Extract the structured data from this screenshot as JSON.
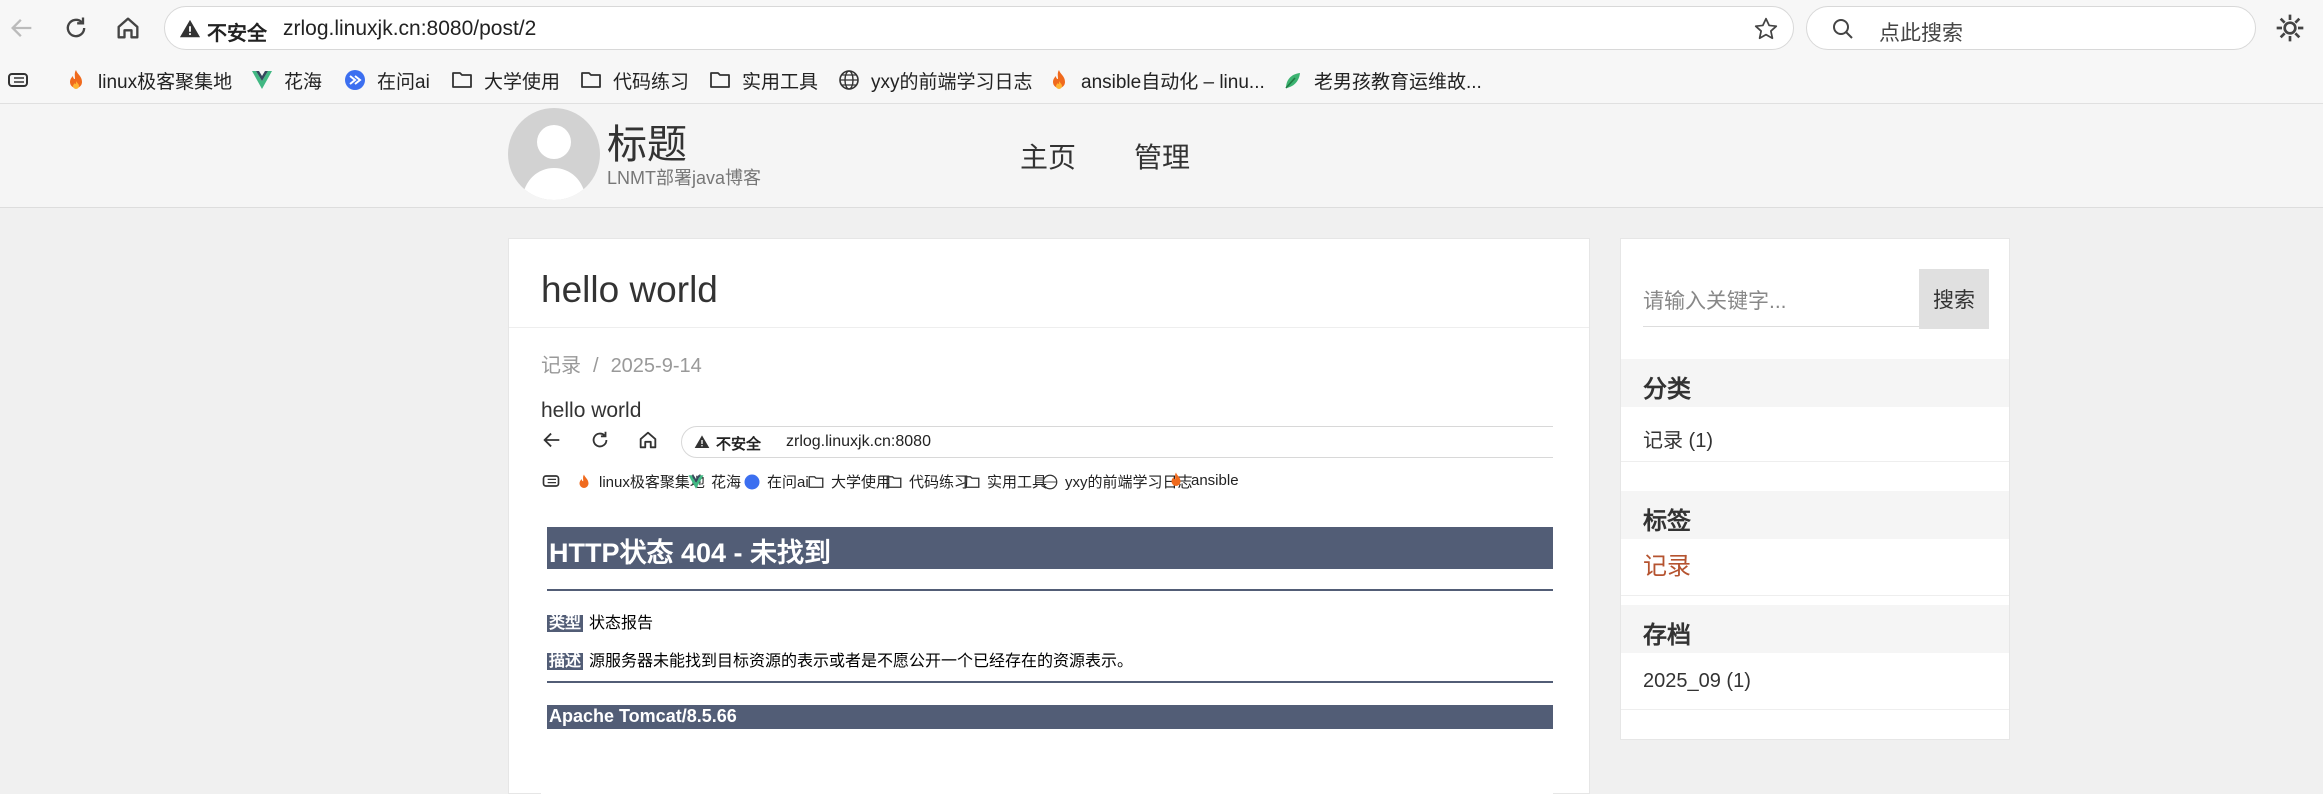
{
  "browser": {
    "insecure_label": "不安全",
    "url": "zrlog.linuxjk.cn:8080/post/2",
    "search_placeholder": "点此搜索"
  },
  "bookmarks": [
    {
      "label": "linux极客聚集地",
      "icon": "flame-icon"
    },
    {
      "label": "花海",
      "icon": "vue-icon"
    },
    {
      "label": "在问ai",
      "icon": "ai-icon"
    },
    {
      "label": "大学使用",
      "icon": "folder-icon"
    },
    {
      "label": "代码练习",
      "icon": "folder-icon"
    },
    {
      "label": "实用工具",
      "icon": "folder-icon"
    },
    {
      "label": "yxy的前端学习日志",
      "icon": "globe-icon"
    },
    {
      "label": "ansible自动化 – linu...",
      "icon": "flame-icon"
    },
    {
      "label": "老男孩教育运维故...",
      "icon": "leaf-icon"
    }
  ],
  "site": {
    "title": "标题",
    "subtitle": "LNMT部署java博客",
    "menu": [
      "主页",
      "管理"
    ]
  },
  "post": {
    "title": "hello world",
    "category": "记录",
    "separator": "/",
    "date": "2025-9-14",
    "body": "hello world"
  },
  "screenshot": {
    "insecure_label": "不安全",
    "url": "zrlog.linuxjk.cn:8080",
    "bookmarks": [
      "linux极客聚集地",
      "花海",
      "在问ai",
      "大学使用",
      "代码练习",
      "实用工具",
      "yxy的前端学习日志",
      "ansible"
    ],
    "error_title": "HTTP状态 404 - 未找到",
    "type_label": "类型",
    "type_value": "状态报告",
    "desc_label": "描述",
    "desc_value": "源服务器未能找到目标资源的表示或者是不愿公开一个已经存在的资源表示。",
    "server": "Apache Tomcat/8.5.66"
  },
  "sidebar": {
    "search_placeholder": "请输入关键字...",
    "search_button": "搜索",
    "categories_title": "分类",
    "category_item": "记录 (1)",
    "tags_title": "标签",
    "tag_item": "记录",
    "archive_title": "存档",
    "archive_item": "2025_09 (1)"
  },
  "colors": {
    "tomcat_header": "#525d76",
    "tag_link": "#b5532f"
  }
}
